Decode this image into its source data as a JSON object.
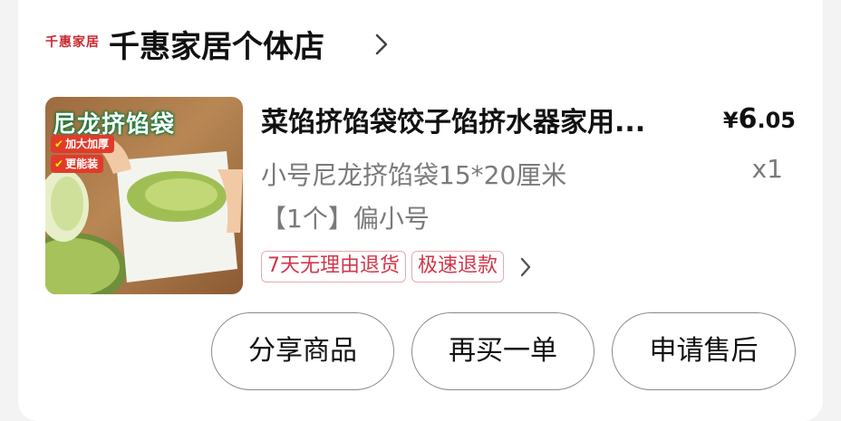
{
  "shop": {
    "logo_text": "千惠家居",
    "name": "千惠家居个体店",
    "chevron_icon": "chevron-right-icon"
  },
  "product": {
    "image_title": "尼龙挤馅袋",
    "image_badges": [
      "加大加厚",
      "更能装"
    ],
    "title": "菜馅挤馅袋饺子馅挤水器家用...",
    "price": {
      "currency": "¥",
      "integer": "6",
      "decimal": ".05"
    },
    "spec_line1": "小号尼龙挤馅袋15*20厘米",
    "spec_line2": "【1个】偏小号",
    "quantity": "x1"
  },
  "tags": [
    "7天无理由退货",
    "极速退款"
  ],
  "actions": {
    "share_label": "分享商品",
    "rebuy_label": "再买一单",
    "after_sale_label": "申请售后"
  },
  "colors": {
    "accent_red": "#d2364a",
    "tag_border": "#e7a9b0",
    "text_primary": "#111111",
    "text_secondary": "#7a7a7a"
  }
}
